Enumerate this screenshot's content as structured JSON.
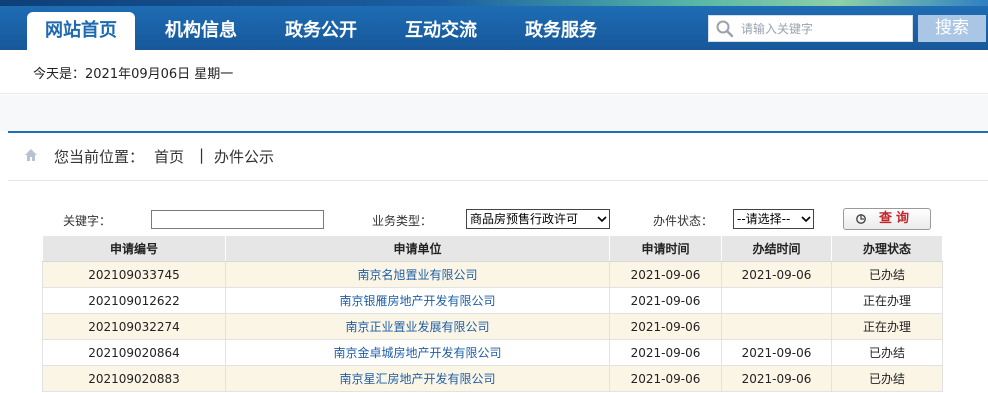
{
  "nav": {
    "items": [
      {
        "label": "网站首页",
        "active": true
      },
      {
        "label": "机构信息",
        "active": false
      },
      {
        "label": "政务公开",
        "active": false
      },
      {
        "label": "互动交流",
        "active": false
      },
      {
        "label": "政务服务",
        "active": false
      }
    ],
    "search_placeholder": "请输入关键字",
    "search_button": "搜索"
  },
  "date": {
    "text": "今天是：2021年09月06日  星期一"
  },
  "breadcrumb": {
    "prefix": "您当前位置：",
    "home": "首页",
    "separator": "|",
    "current": "办件公示"
  },
  "filters": {
    "keyword_label": "关键字：",
    "keyword_value": "",
    "business_type_label": "业务类型：",
    "business_type_value": "商品房预售行政许可",
    "status_label": "办件状态：",
    "status_value": "--请选择--",
    "query_button": "查询"
  },
  "table": {
    "headers": [
      "申请编号",
      "申请单位",
      "申请时间",
      "办结时间",
      "办理状态"
    ],
    "rows": [
      [
        "202109033745",
        "南京名旭置业有限公司",
        "2021-09-06",
        "2021-09-06",
        "已办结"
      ],
      [
        "202109012622",
        "南京银雁房地产开发有限公司",
        "2021-09-06",
        "",
        "正在办理"
      ],
      [
        "202109032274",
        "南京正业置业发展有限公司",
        "2021-09-06",
        "",
        "正在办理"
      ],
      [
        "202109020864",
        "南京金卓城房地产开发有限公司",
        "2021-09-06",
        "2021-09-06",
        "已办结"
      ],
      [
        "202109020883",
        "南京星汇房地产开发有限公司",
        "2021-09-06",
        "2021-09-06",
        "已办结"
      ]
    ]
  },
  "colors": {
    "nav_blue": "#1d6ab1",
    "odd_row": "#fbf5e6",
    "link_blue": "#1f5ea8",
    "query_red": "#c0272d"
  },
  "icons": {
    "search": "search-icon",
    "home": "home-icon",
    "select_arrow": "chevron-down-icon",
    "query": "magnifier-icon"
  }
}
